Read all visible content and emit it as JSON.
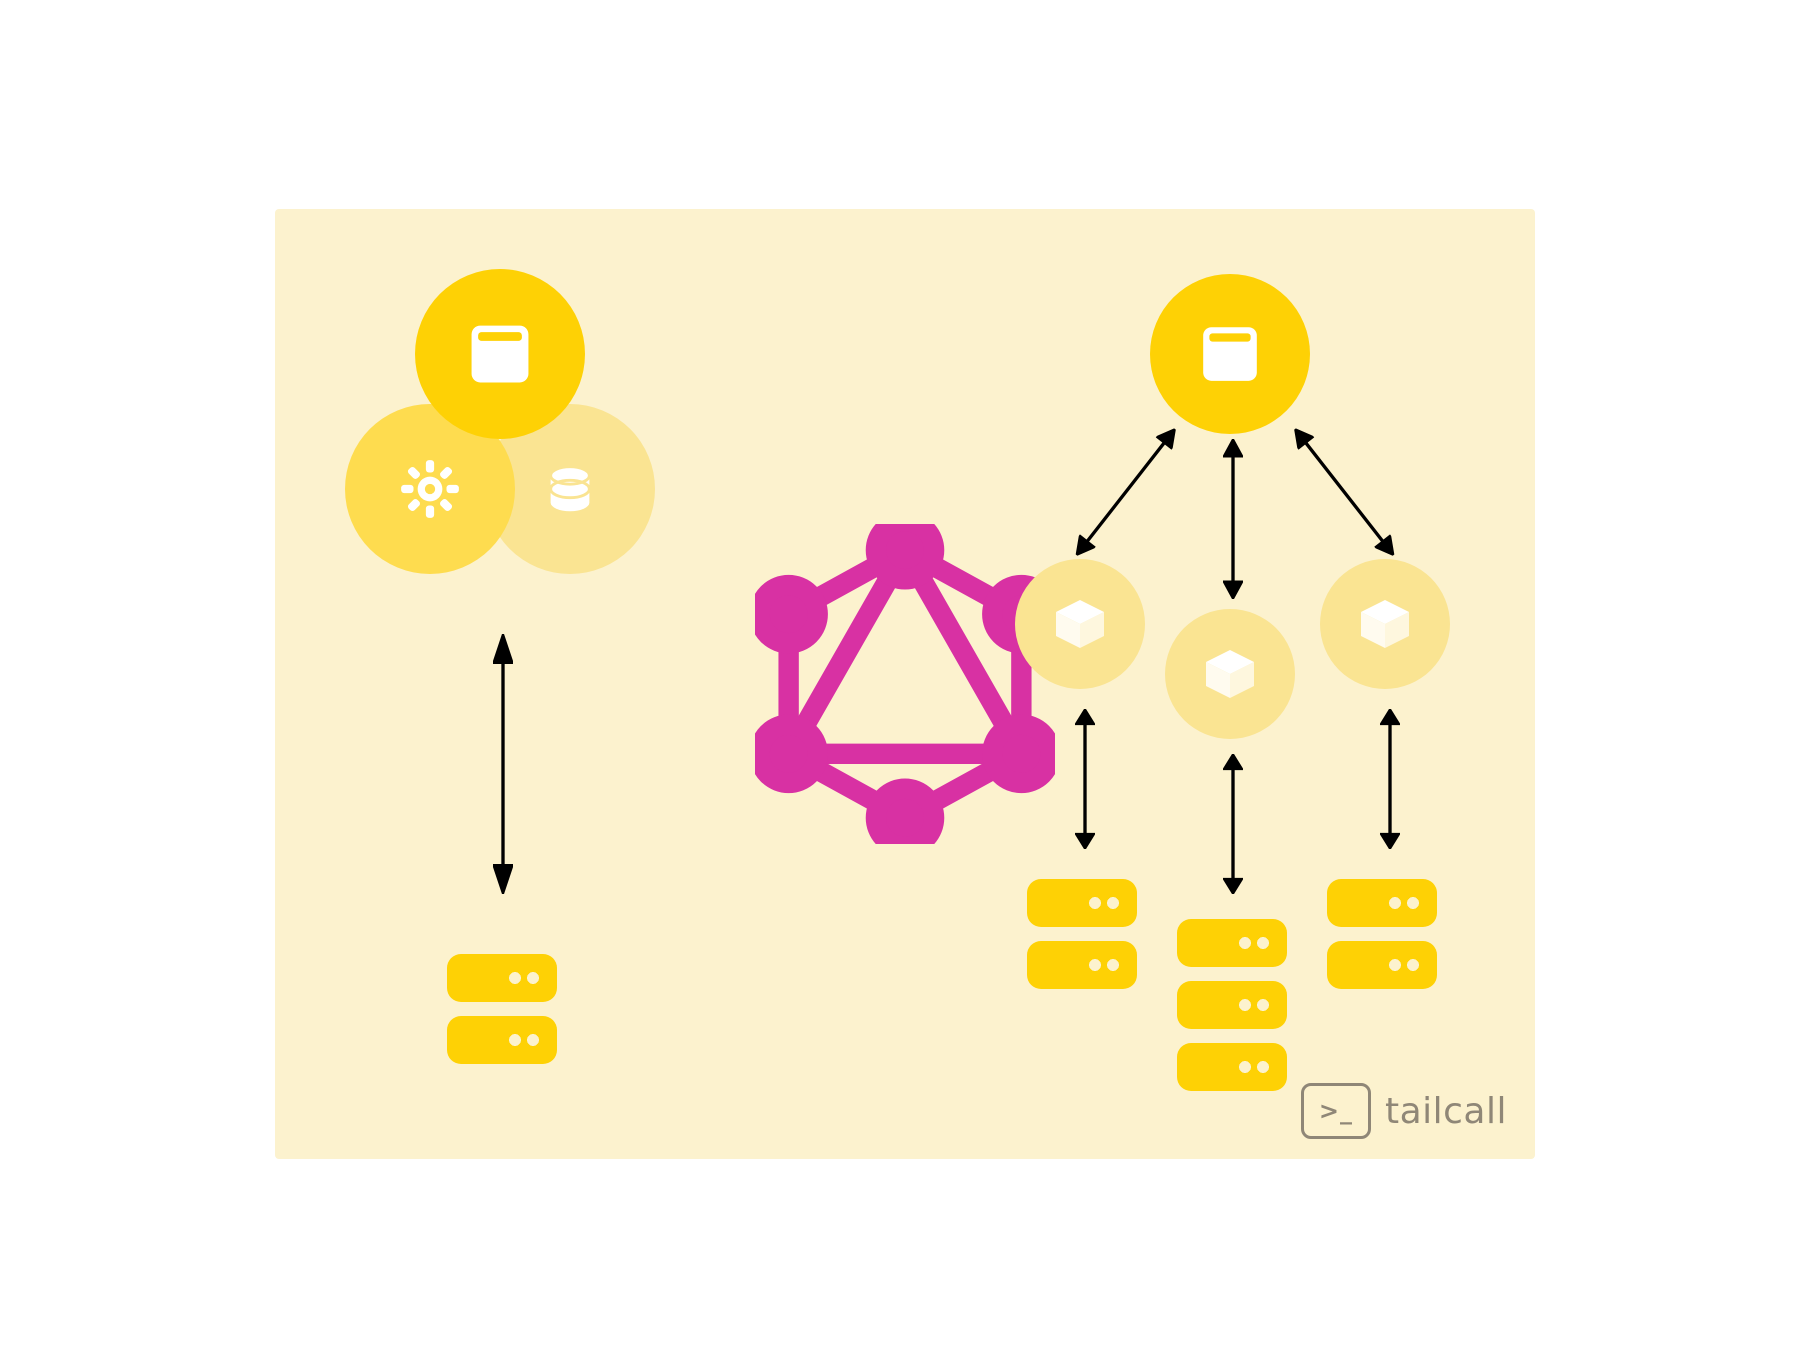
{
  "brand": {
    "symbol": ">_",
    "name": "tailcall"
  },
  "colors": {
    "bg": "#FCF2CE",
    "yellow_strong": "#FED105",
    "yellow_mid": "#FEDC4F",
    "yellow_soft": "#FAE492",
    "magenta": "#D831A3",
    "arrow": "#000000",
    "icon_white": "#FFFFFF"
  },
  "diagram": {
    "left_cluster": {
      "description": "monolith — single deployment with UI, config, data layers talking to one server",
      "nodes": [
        {
          "id": "ui",
          "icon": "browser-icon",
          "tint": "strong"
        },
        {
          "id": "settings",
          "icon": "gear-icon",
          "tint": "mid"
        },
        {
          "id": "data",
          "icon": "database-icon",
          "tint": "soft"
        }
      ],
      "server_count": 2
    },
    "center": {
      "id": "graphql-logo",
      "icon": "graphql-icon",
      "color": "#D831A3"
    },
    "right_cluster": {
      "description": "microservices — UI talks to 3 services, each with its own servers",
      "root": {
        "id": "ui",
        "icon": "browser-icon",
        "tint": "strong"
      },
      "services": [
        {
          "id": "svc-a",
          "icon": "cube-icon",
          "server_count": 2
        },
        {
          "id": "svc-b",
          "icon": "cube-icon",
          "server_count": 3
        },
        {
          "id": "svc-c",
          "icon": "cube-icon",
          "server_count": 2
        }
      ]
    }
  }
}
